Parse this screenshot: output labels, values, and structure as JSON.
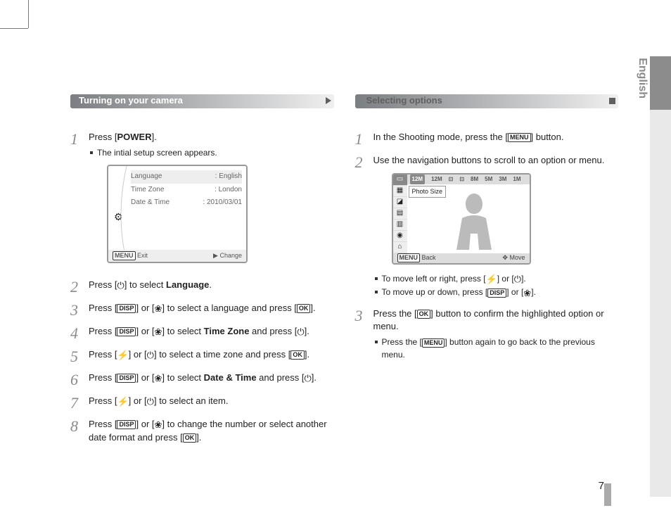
{
  "side_label": "English",
  "page_number": "7",
  "left": {
    "heading": "Turning on your camera",
    "steps": {
      "s1": {
        "num": "1",
        "main_pre": "Press [",
        "main_btn": "POWER",
        "main_post": "].",
        "sub1": "The intial setup screen appears."
      },
      "s2": {
        "num": "2",
        "pre": "Press [",
        "post": "] to select ",
        "bold": "Language",
        "end": "."
      },
      "s3": {
        "num": "3",
        "pre": "Press [",
        "mid": "] or [",
        "post": "] to select a language and press [",
        "end": "]."
      },
      "s4": {
        "num": "4",
        "pre": "Press [",
        "mid": "] or [",
        "post": "] to select ",
        "bold": "Time Zone",
        "after": " and press [",
        "end": "]."
      },
      "s5": {
        "num": "5",
        "pre": "Press [",
        "mid": "] or [",
        "post": "] to select a time zone and press [",
        "end": "]."
      },
      "s6": {
        "num": "6",
        "pre": "Press [",
        "mid": "] or [",
        "post": "] to select ",
        "bold": "Date & Time",
        "after": " and press [",
        "end": "]."
      },
      "s7": {
        "num": "7",
        "pre": "Press [",
        "mid": "] or [",
        "post": "] to select an item."
      },
      "s8": {
        "num": "8",
        "pre": "Press [",
        "mid": "] or [",
        "post": "] to change the number or select another date format and press [",
        "end": "]."
      }
    },
    "screen": {
      "rows": {
        "r1": {
          "label": "Language",
          "value": ": English"
        },
        "r2": {
          "label": "Time Zone",
          "value": ": London"
        },
        "r3": {
          "label": "Date & Time",
          "value": ": 2010/03/01"
        }
      },
      "footer": {
        "left_icon": "MENU",
        "left": "Exit",
        "right_icon": "▶",
        "right": "Change"
      }
    }
  },
  "right": {
    "heading": "Selecting options",
    "steps": {
      "s1": {
        "num": "1",
        "pre": "In the Shooting mode, press the [",
        "post": "] button."
      },
      "s2": {
        "num": "2",
        "text": "Use the navigation buttons to scroll to an option or menu."
      },
      "s2sub": {
        "a_pre": "To move left or right, press [",
        "a_mid": "] or [",
        "a_post": "].",
        "b_pre": "To move up or down, press [",
        "b_mid": "] or [",
        "b_post": "]."
      },
      "s3": {
        "num": "3",
        "pre": "Press the [",
        "post": "] button to confirm the highlighted option or menu.",
        "sub_pre": "Press the [",
        "sub_post": "] button again to go back to the previous menu."
      }
    },
    "screen": {
      "top": {
        "i1": "12M",
        "i2": "12M",
        "i3": "⊡",
        "i4": "⊡",
        "i5": "8M",
        "i6": "5M",
        "i7": "3M",
        "i8": "1M"
      },
      "tooltip": "Photo Size",
      "footer": {
        "left_icon": "MENU",
        "left": "Back",
        "right_icon": "✥",
        "right": "Move"
      }
    }
  },
  "icons": {
    "disp": "DISP",
    "ok": "OK",
    "menu": "MENU",
    "flower": "❀",
    "timer": "⏻",
    "flash": "⚡"
  }
}
